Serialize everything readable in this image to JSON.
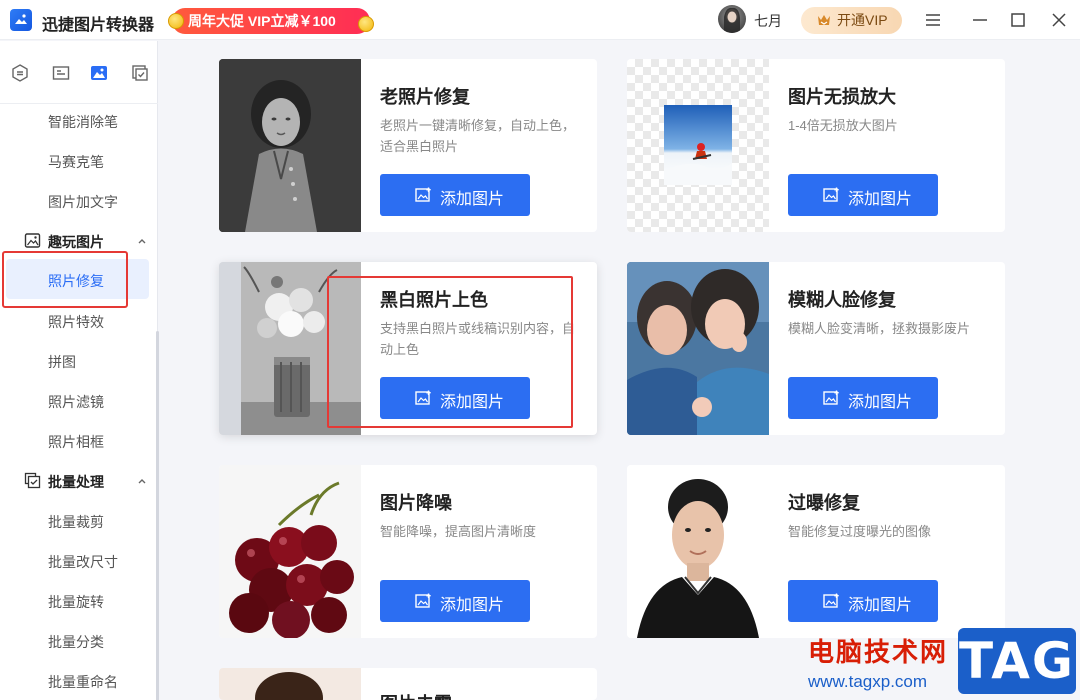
{
  "app": {
    "title": "迅捷图片转换器"
  },
  "promo": {
    "label": "周年大促 VIP立减￥100"
  },
  "user": {
    "name": "七月"
  },
  "vip": {
    "label": "开通VIP"
  },
  "sidebar": {
    "items_top": [
      "智能消除笔",
      "马赛克笔",
      "图片加文字"
    ],
    "section_fun": "趣玩图片",
    "fun_items": [
      "照片修复",
      "照片特效",
      "拼图",
      "照片滤镜",
      "照片相框"
    ],
    "active_item": "照片修复",
    "section_batch": "批量处理",
    "batch_items": [
      "批量裁剪",
      "批量改尺寸",
      "批量旋转",
      "批量分类",
      "批量重命名"
    ]
  },
  "cards": [
    {
      "title": "老照片修复",
      "desc": "老照片一键清晰修复，自动上色，适合黑白照片",
      "button": "添加图片"
    },
    {
      "title": "图片无损放大",
      "desc": "1-4倍无损放大图片",
      "button": "添加图片"
    },
    {
      "title": "黑白照片上色",
      "desc": "支持黑白照片或线稿识别内容，自动上色",
      "button": "添加图片"
    },
    {
      "title": "模糊人脸修复",
      "desc": "模糊人脸变清晰，拯救摄影废片",
      "button": "添加图片"
    },
    {
      "title": "图片降噪",
      "desc": "智能降噪，提高图片清晰度",
      "button": "添加图片"
    },
    {
      "title": "过曝修复",
      "desc": "智能修复过度曝光的图像",
      "button": "添加图片"
    },
    {
      "title": "图片去雾"
    }
  ],
  "watermark": {
    "text": "电脑技术网",
    "url": "www.tagxp.com",
    "tag": "TAG"
  },
  "colors": {
    "accent": "#2c6ef2",
    "highlight": "#e53935",
    "sidebar_active_bg": "#e9f0fe"
  }
}
